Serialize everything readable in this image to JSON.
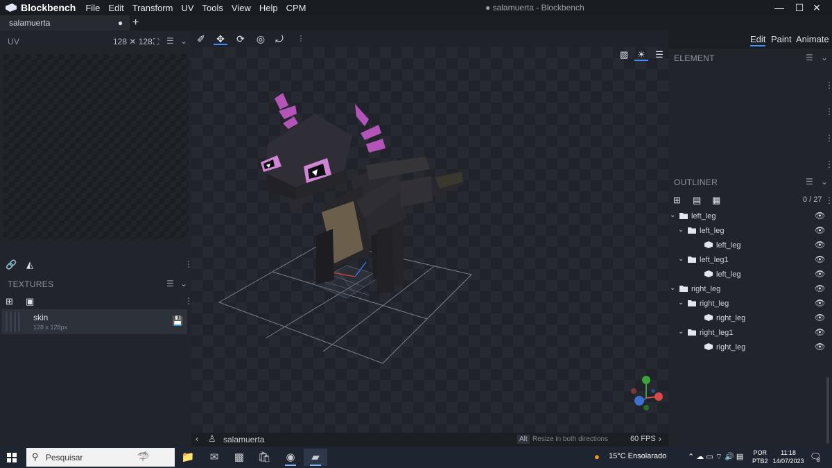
{
  "app": {
    "name": "Blockbench",
    "window_title": "● salamuerta - Blockbench",
    "menu": [
      "File",
      "Edit",
      "Transform",
      "UV",
      "Tools",
      "View",
      "Help",
      "CPM"
    ],
    "window_controls": {
      "minimize": "—",
      "maximize": "☐",
      "close": "✕"
    }
  },
  "tabs": {
    "active_label": "salamuerta",
    "unsaved_dot": "●",
    "add": "+"
  },
  "left_panel": {
    "uv": {
      "title": "UV",
      "size": "128 ✕ 128"
    },
    "textures": {
      "title": "TEXTURES",
      "items": [
        {
          "name": "skin",
          "size": "128 x 128px"
        }
      ]
    }
  },
  "mode_tabs": [
    "Edit",
    "Paint",
    "Animate"
  ],
  "element_panel": {
    "title": "ELEMENT"
  },
  "outliner": {
    "title": "OUTLINER",
    "count": "0 / 27",
    "rows": [
      {
        "label": "left_leg",
        "type": "group",
        "depth": 0,
        "expanded": true
      },
      {
        "label": "left_leg",
        "type": "group",
        "depth": 1,
        "expanded": true
      },
      {
        "label": "left_leg",
        "type": "cube",
        "depth": 2
      },
      {
        "label": "left_leg1",
        "type": "group",
        "depth": 1,
        "expanded": true
      },
      {
        "label": "left_leg",
        "type": "cube",
        "depth": 2
      },
      {
        "label": "right_leg",
        "type": "group",
        "depth": 0,
        "expanded": true
      },
      {
        "label": "right_leg",
        "type": "group",
        "depth": 1,
        "expanded": true
      },
      {
        "label": "right_leg",
        "type": "cube",
        "depth": 2
      },
      {
        "label": "right_leg1",
        "type": "group",
        "depth": 1,
        "expanded": true
      },
      {
        "label": "right_leg",
        "type": "cube",
        "depth": 2
      }
    ]
  },
  "status_bar": {
    "model_name": "salamuerta",
    "key_hint": "Alt",
    "hint": "Resize in both directions",
    "fps": "60 FPS"
  },
  "taskbar": {
    "search_placeholder": "Pesquisar",
    "weather": "15°C  Ensolarado",
    "lang_top": "POR",
    "lang_bottom": "PTB2",
    "time": "11:18",
    "date": "14/07/2023",
    "notif_count": "3"
  },
  "colors": {
    "accent": "#3e90ff",
    "model_body": "#2b2a30",
    "model_belly": "#6b5e4a",
    "model_horns": "#b554b8"
  }
}
